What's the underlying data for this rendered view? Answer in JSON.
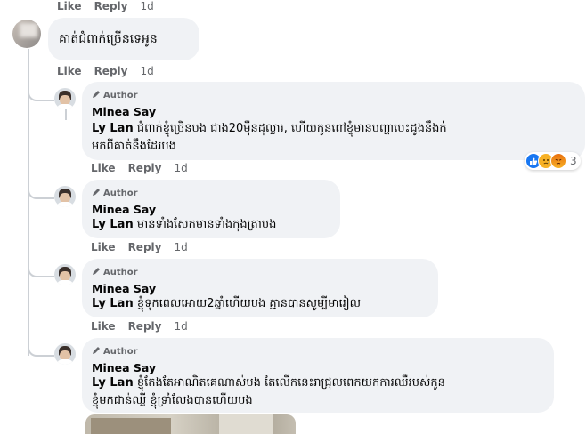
{
  "top_actions": {
    "like": "Like",
    "reply": "Reply",
    "time": "1d"
  },
  "root_comment": {
    "text": "គាត់ជំពាក់ច្រើនទេអូន",
    "like": "Like",
    "reply": "Reply",
    "time": "1d"
  },
  "replies": [
    {
      "badge": "Author",
      "author": "Minea Say",
      "mention": "Ly Lan",
      "line1": "ជំពាក់ខ្ញុំច្រើនបង ជាង20ម៉ឺនដុល្លារ, ហើយកូនពៅខ្ញុំមានបញ្ហាបេះដូងនឹងក់",
      "line2": "មកពីគាត់នឹងដែរបង",
      "like": "Like",
      "reply": "Reply",
      "time": "1d",
      "reaction_count": "3"
    },
    {
      "badge": "Author",
      "author": "Minea Say",
      "mention": "Ly Lan",
      "line1": "មានទាំងសែកមានទាំងកុងត្រាបង",
      "like": "Like",
      "reply": "Reply",
      "time": "1d"
    },
    {
      "badge": "Author",
      "author": "Minea Say",
      "mention": "Ly Lan",
      "line1": "ខ្ញុំទុកពេលអោយ2ឆ្នាំហើយបង គ្មានបានសូម្បីមារៀល",
      "like": "Like",
      "reply": "Reply",
      "time": "1d"
    },
    {
      "badge": "Author",
      "author": "Minea Say",
      "mention": "Ly Lan",
      "line1": "ខ្ញុំតែងតែអាណិតគេណាស់បង តែលើកនេះរាជ្រុលពេកយកការឈឺរបស់កូន",
      "line2": "ខ្ញុំមកជាន់ឈ្លី ខ្ញុំទ្រាំលែងបានហើយបង"
    }
  ],
  "colors": {
    "bubble": "#f0f2f5",
    "meta": "#65676b",
    "like_reaction": "#1877f2",
    "sad_reaction": "#f7b125",
    "angry_reaction": "#e9710f"
  },
  "icons": {
    "author_badge": "pencil-icon",
    "reactions": [
      "like-reaction-icon",
      "sad-reaction-icon",
      "angry-reaction-icon"
    ]
  }
}
